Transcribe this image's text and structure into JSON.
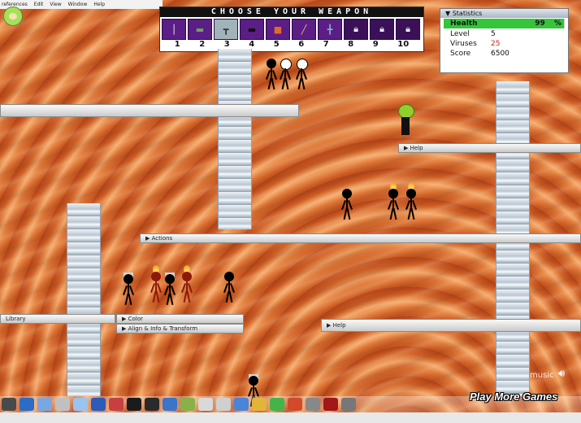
{
  "menubar": {
    "items": [
      "references",
      "Edit",
      "View",
      "Window",
      "Help"
    ]
  },
  "weapons": {
    "title": "CHOOSE YOUR WEAPON",
    "slots": [
      {
        "number": "1",
        "icon": "knife-icon",
        "locked": false,
        "selected": false
      },
      {
        "number": "2",
        "icon": "spiked-club-icon",
        "locked": false,
        "selected": false
      },
      {
        "number": "3",
        "icon": "hammer-icon",
        "locked": false,
        "selected": true
      },
      {
        "number": "4",
        "icon": "shotgun-icon",
        "locked": false,
        "selected": false
      },
      {
        "number": "5",
        "icon": "brick-icon",
        "locked": false,
        "selected": false
      },
      {
        "number": "6",
        "icon": "baseball-bat-icon",
        "locked": false,
        "selected": false
      },
      {
        "number": "7",
        "icon": "axe-icon",
        "locked": false,
        "selected": false
      },
      {
        "number": "8",
        "icon": "lock-icon",
        "locked": true,
        "selected": false
      },
      {
        "number": "9",
        "icon": "lock-icon",
        "locked": true,
        "selected": false
      },
      {
        "number": "10",
        "icon": "lock-icon",
        "locked": true,
        "selected": false
      }
    ]
  },
  "stats": {
    "title": "Statistics",
    "health_label": "Health",
    "health_value": "99",
    "health_unit": "%",
    "health_fraction": 0.99,
    "level_label": "Level",
    "level_value": "5",
    "viruses_label": "Viruses",
    "viruses_value": "25",
    "score_label": "Score",
    "score_value": "6500"
  },
  "panels": {
    "help_top": "Help",
    "actions": "Actions",
    "library": "Library",
    "color": "Color",
    "align": "Align & Info & Transform",
    "help_bottom": "Help"
  },
  "footer": {
    "play_more": "Play More Games",
    "music": "music"
  },
  "colors": {
    "health_green": "#34c53a",
    "viruses_red": "#d32424",
    "slot_purple": "#5b1d86"
  }
}
